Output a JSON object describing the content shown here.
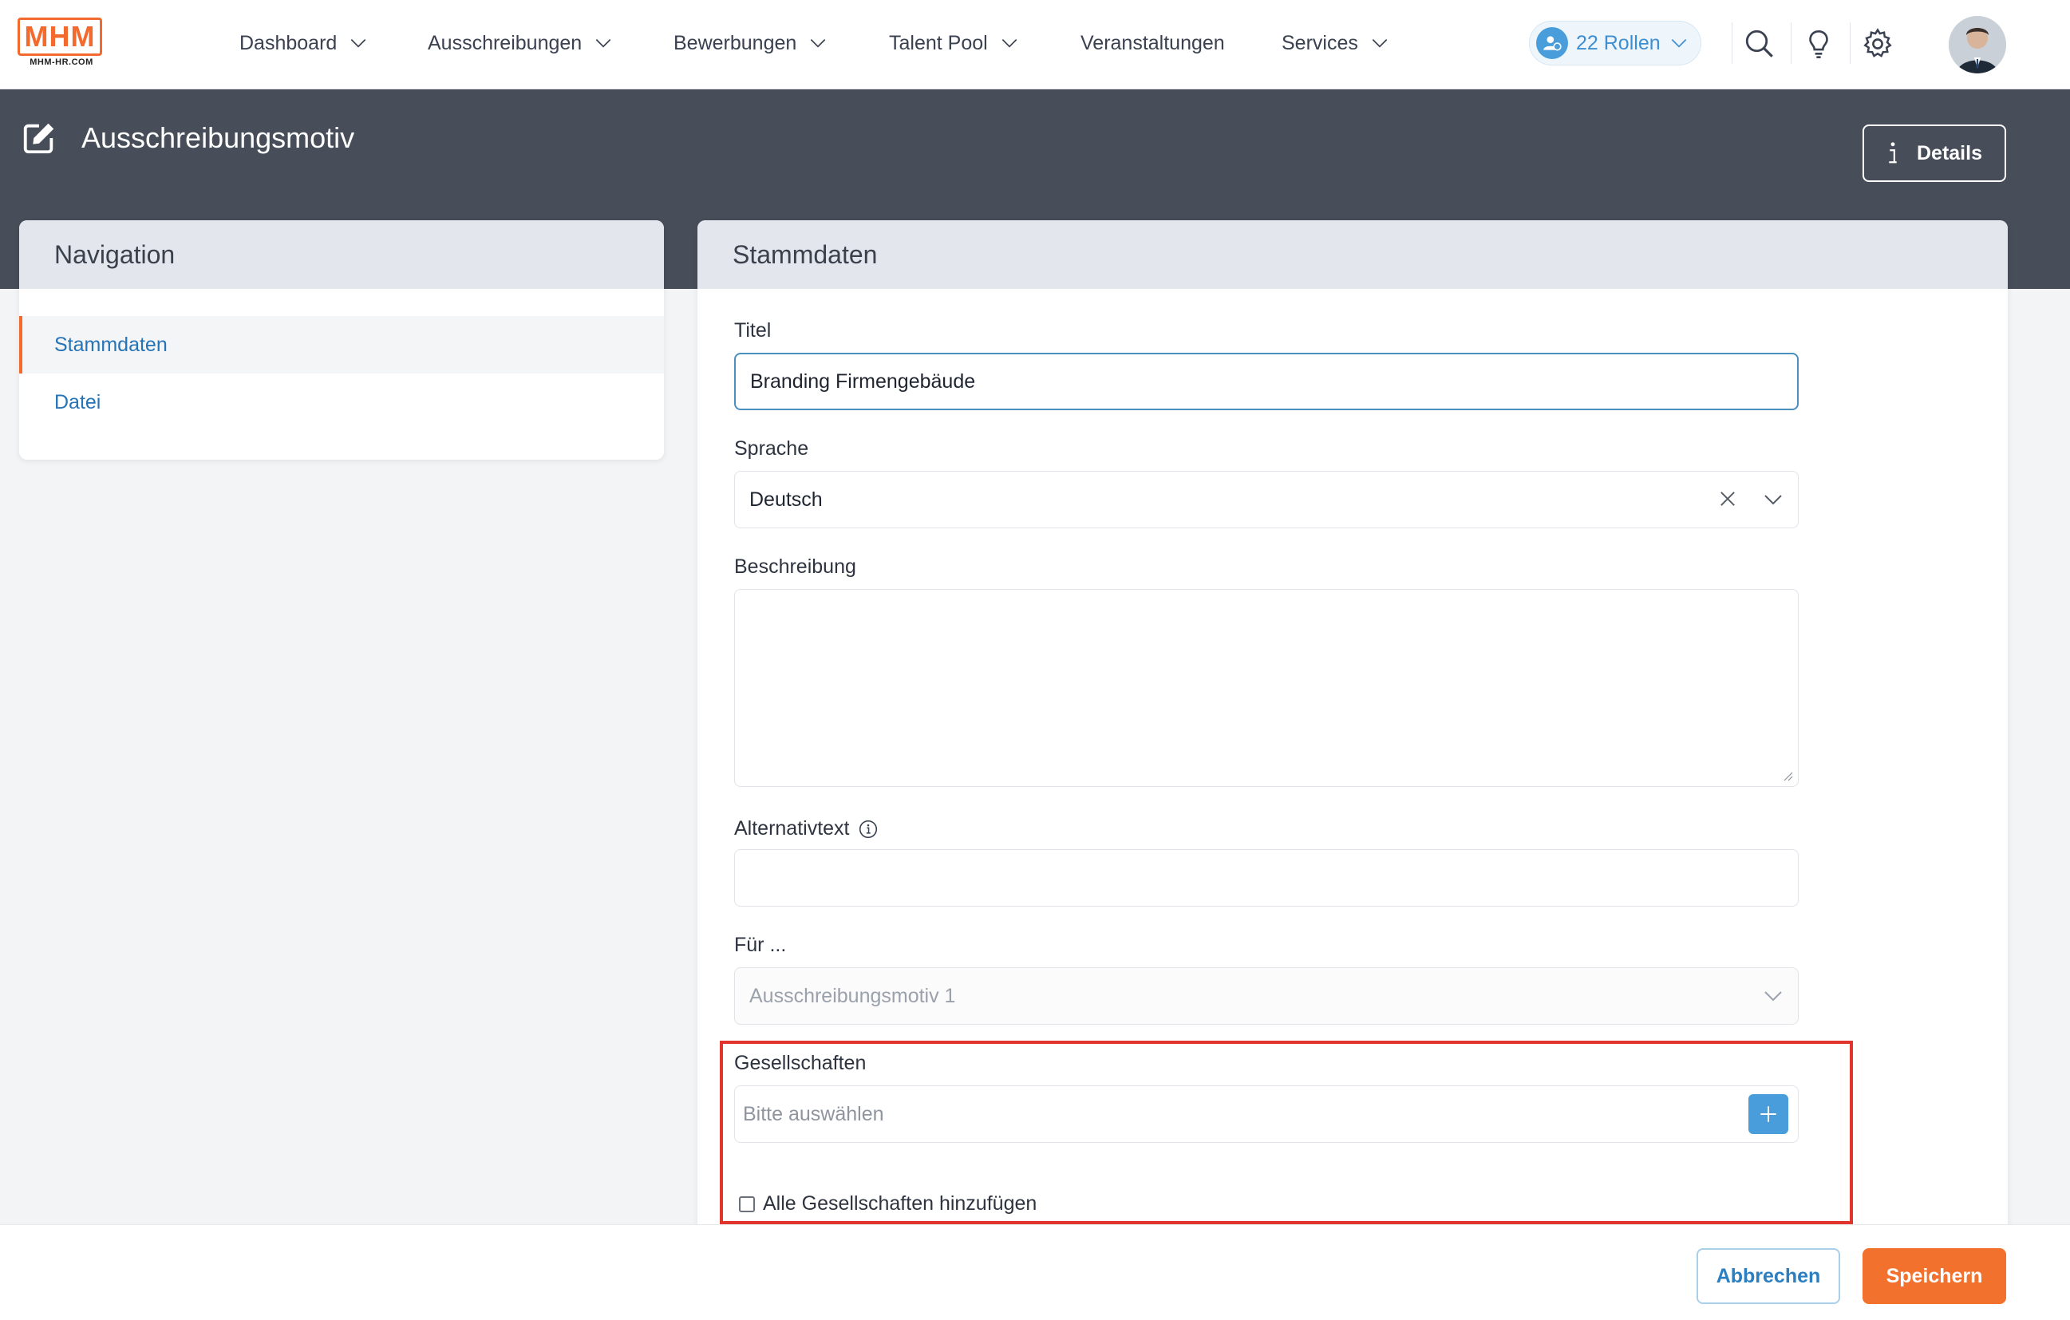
{
  "brand": {
    "logo_text": "MHM",
    "logo_sub": "MHM-HR.COM",
    "accent": "#f26a2e"
  },
  "topnav": {
    "items": [
      {
        "label": "Dashboard",
        "has_dropdown": true
      },
      {
        "label": "Ausschreibungen",
        "has_dropdown": true
      },
      {
        "label": "Bewerbungen",
        "has_dropdown": true
      },
      {
        "label": "Talent Pool",
        "has_dropdown": true
      },
      {
        "label": "Veranstaltungen",
        "has_dropdown": false
      },
      {
        "label": "Services",
        "has_dropdown": true
      }
    ],
    "roles_label": "22 Rollen",
    "icons": [
      "search-icon",
      "lightbulb-icon",
      "gear-icon"
    ]
  },
  "header": {
    "title": "Ausschreibungsmotiv",
    "details_label": "Details"
  },
  "navigation": {
    "title": "Navigation",
    "items": [
      {
        "label": "Stammdaten",
        "active": true
      },
      {
        "label": "Datei",
        "active": false
      }
    ]
  },
  "form": {
    "title": "Stammdaten",
    "titel_label": "Titel",
    "titel_value": "Branding Firmengebäude",
    "sprache_label": "Sprache",
    "sprache_value": "Deutsch",
    "beschreibung_label": "Beschreibung",
    "beschreibung_value": "",
    "alternativtext_label": "Alternativtext",
    "alternativtext_value": "",
    "fuer_label": "Für ...",
    "fuer_value": "Ausschreibungsmotiv 1",
    "gesellschaften_label": "Gesellschaften",
    "gesellschaften_placeholder": "Bitte auswählen",
    "alle_gesellschaften_label": "Alle Gesellschaften hinzufügen",
    "alle_gesellschaften_checked": false
  },
  "footer": {
    "cancel_label": "Abbrechen",
    "save_label": "Speichern"
  }
}
